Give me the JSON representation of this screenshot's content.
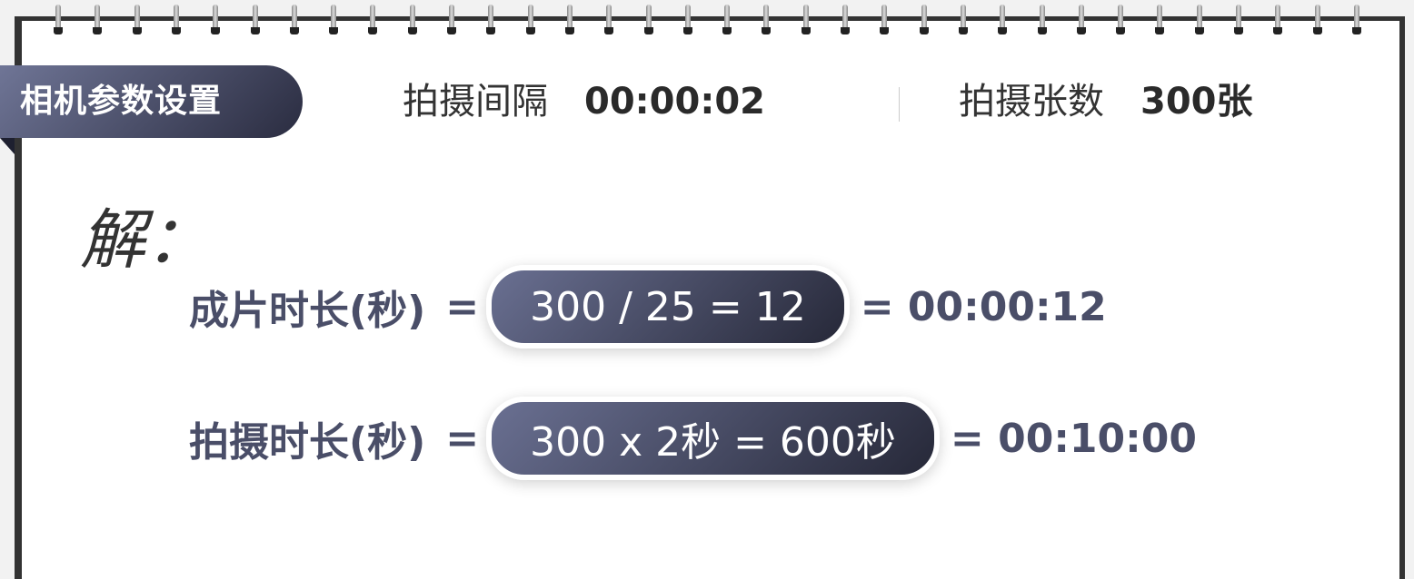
{
  "ribbon": {
    "title": "相机参数设置"
  },
  "params": [
    {
      "label": "拍摄间隔",
      "value": "00:00:02"
    },
    {
      "label": "拍摄张数",
      "value": "300张"
    }
  ],
  "solution_label": "解：",
  "formulas": [
    {
      "label": "成片时长(秒)",
      "eq": "=",
      "expr": "300 / 25 = 12",
      "result": "= 00:00:12"
    },
    {
      "label": "拍摄时长(秒)",
      "eq": "=",
      "expr": "300 x 2秒 = 600秒",
      "result": "= 00:10:00"
    }
  ],
  "colors": {
    "frame": "#333333",
    "ribbon_start": "#6f7596",
    "ribbon_end": "#2a2c40",
    "formula_text": "#4a4e68"
  }
}
